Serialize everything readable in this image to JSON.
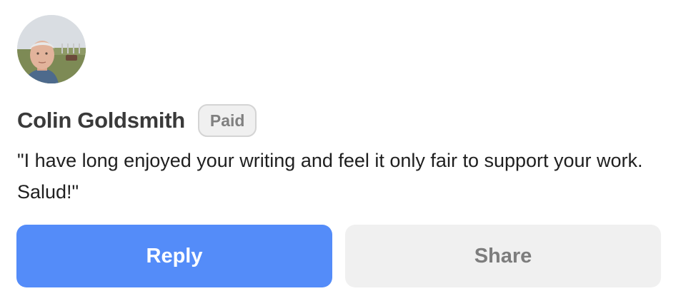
{
  "comment": {
    "author_name": "Colin Goldsmith",
    "badge": "Paid",
    "avatar_icon": "avatar-photo",
    "message": "\"I have long enjoyed your writing and feel it only fair to support your work. Salud!\""
  },
  "actions": {
    "reply_label": "Reply",
    "share_label": "Share"
  },
  "colors": {
    "primary": "#548cf9",
    "secondary_bg": "#f0f0f0",
    "badge_border": "#d4d4d4",
    "text": "#1f1f1f"
  }
}
